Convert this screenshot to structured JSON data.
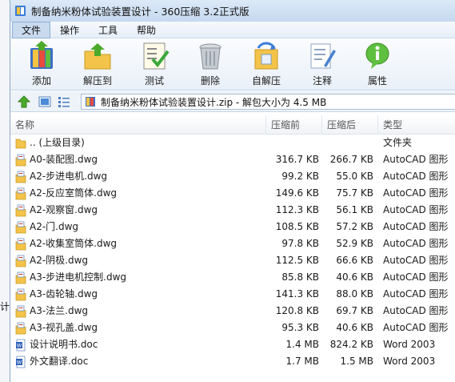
{
  "window": {
    "title": "制备纳米粉体试验装置设计 - 360压缩 3.2正式版"
  },
  "menu": {
    "items": [
      {
        "label": "文件",
        "active": true
      },
      {
        "label": "操作",
        "active": false
      },
      {
        "label": "工具",
        "active": false
      },
      {
        "label": "帮助",
        "active": false
      }
    ]
  },
  "toolbar": {
    "buttons": [
      {
        "label": "添加",
        "icon": "add-archive-icon"
      },
      {
        "label": "解压到",
        "icon": "extract-to-icon"
      },
      {
        "label": "测试",
        "icon": "test-icon"
      },
      {
        "label": "删除",
        "icon": "delete-icon"
      },
      {
        "label": "自解压",
        "icon": "self-extract-icon"
      },
      {
        "label": "注释",
        "icon": "comment-icon"
      },
      {
        "label": "属性",
        "icon": "info-icon"
      }
    ]
  },
  "address": {
    "text": "制备纳米粉体试验装置设计.zip - 解包大小为 4.5 MB"
  },
  "columns": {
    "name": "名称",
    "size": "压缩前",
    "compressed": "压缩后",
    "type": "类型"
  },
  "files": [
    {
      "name": ".. (上级目录)",
      "size": "",
      "compressed": "",
      "type": "文件夹",
      "icon": "folder"
    },
    {
      "name": "A0-装配图.dwg",
      "size": "316.7 KB",
      "compressed": "266.7 KB",
      "type": "AutoCAD 图形",
      "icon": "dwg"
    },
    {
      "name": "A2-步进电机.dwg",
      "size": "99.2 KB",
      "compressed": "55.0 KB",
      "type": "AutoCAD 图形",
      "icon": "dwg"
    },
    {
      "name": "A2-反应室筒体.dwg",
      "size": "149.6 KB",
      "compressed": "75.7 KB",
      "type": "AutoCAD 图形",
      "icon": "dwg"
    },
    {
      "name": "A2-观察窗.dwg",
      "size": "112.3 KB",
      "compressed": "56.1 KB",
      "type": "AutoCAD 图形",
      "icon": "dwg"
    },
    {
      "name": "A2-门.dwg",
      "size": "108.5 KB",
      "compressed": "57.2 KB",
      "type": "AutoCAD 图形",
      "icon": "dwg"
    },
    {
      "name": "A2-收集室筒体.dwg",
      "size": "97.8 KB",
      "compressed": "52.9 KB",
      "type": "AutoCAD 图形",
      "icon": "dwg"
    },
    {
      "name": "A2-阴极.dwg",
      "size": "112.5 KB",
      "compressed": "66.6 KB",
      "type": "AutoCAD 图形",
      "icon": "dwg"
    },
    {
      "name": "A3-步进电机控制.dwg",
      "size": "85.8 KB",
      "compressed": "40.6 KB",
      "type": "AutoCAD 图形",
      "icon": "dwg"
    },
    {
      "name": "A3-齿轮轴.dwg",
      "size": "141.3 KB",
      "compressed": "88.0 KB",
      "type": "AutoCAD 图形",
      "icon": "dwg"
    },
    {
      "name": "A3-法兰.dwg",
      "size": "120.8 KB",
      "compressed": "69.7 KB",
      "type": "AutoCAD 图形",
      "icon": "dwg"
    },
    {
      "name": "A3-视孔盖.dwg",
      "size": "95.3 KB",
      "compressed": "40.6 KB",
      "type": "AutoCAD 图形",
      "icon": "dwg"
    },
    {
      "name": "设计说明书.doc",
      "size": "1.4 MB",
      "compressed": "824.2 KB",
      "type": "Word 2003",
      "icon": "doc"
    },
    {
      "name": "外文翻译.doc",
      "size": "1.7 MB",
      "compressed": "1.5 MB",
      "type": "Word 2003",
      "icon": "doc"
    }
  ],
  "side_fragment": "计"
}
